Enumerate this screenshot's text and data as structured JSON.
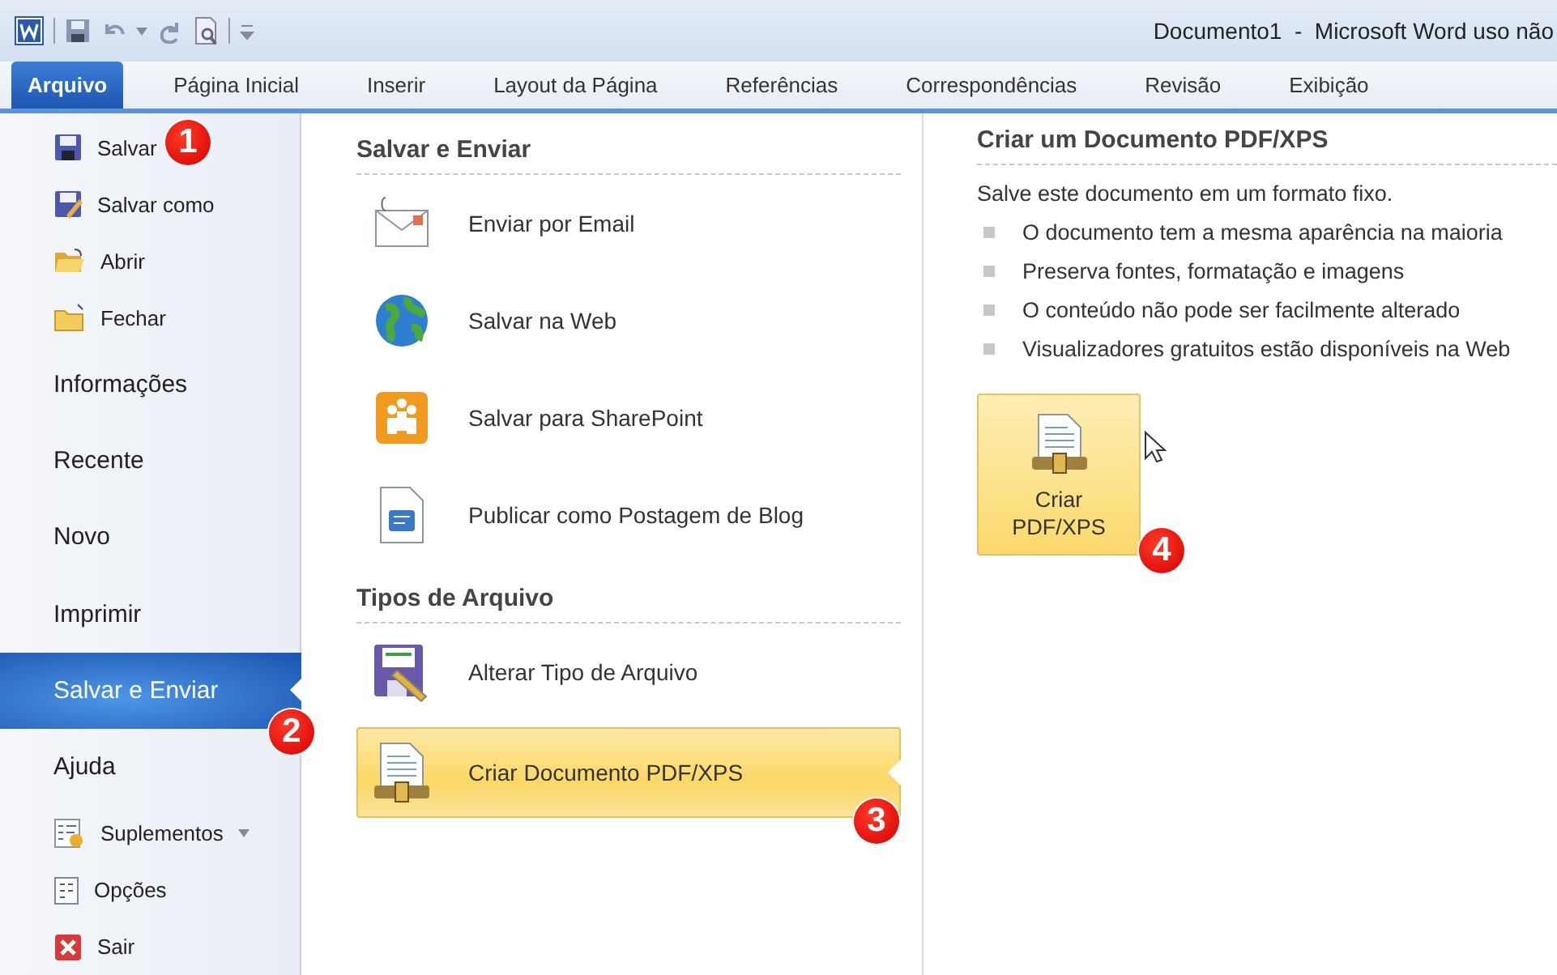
{
  "window": {
    "title": "Documento1  -  Microsoft Word uso não"
  },
  "ribbon_tabs": [
    {
      "label": "Arquivo",
      "selected": true
    },
    {
      "label": "Página Inicial",
      "selected": false
    },
    {
      "label": "Inserir",
      "selected": false
    },
    {
      "label": "Layout da Página",
      "selected": false
    },
    {
      "label": "Referências",
      "selected": false
    },
    {
      "label": "Correspondências",
      "selected": false
    },
    {
      "label": "Revisão",
      "selected": false
    },
    {
      "label": "Exibição",
      "selected": false
    }
  ],
  "backstage_menu": [
    {
      "label": "Salvar",
      "kind": "command",
      "selected": false
    },
    {
      "label": "Salvar como",
      "kind": "command",
      "selected": false
    },
    {
      "label": "Abrir",
      "kind": "command",
      "selected": false
    },
    {
      "label": "Fechar",
      "kind": "command",
      "selected": false
    },
    {
      "label": "Informações",
      "kind": "page",
      "selected": false
    },
    {
      "label": "Recente",
      "kind": "page",
      "selected": false
    },
    {
      "label": "Novo",
      "kind": "page",
      "selected": false
    },
    {
      "label": "Imprimir",
      "kind": "page",
      "selected": false
    },
    {
      "label": "Salvar e Enviar",
      "kind": "page",
      "selected": true
    },
    {
      "label": "Ajuda",
      "kind": "page",
      "selected": false
    },
    {
      "label": "Suplementos",
      "kind": "submenu",
      "selected": false
    },
    {
      "label": "Opções",
      "kind": "command",
      "selected": false
    },
    {
      "label": "Sair",
      "kind": "command",
      "selected": false
    }
  ],
  "save_send": {
    "sections": [
      {
        "title": "Salvar e Enviar",
        "items": [
          {
            "label": "Enviar por Email",
            "selected": false
          },
          {
            "label": "Salvar na Web",
            "selected": false
          },
          {
            "label": "Salvar para SharePoint",
            "selected": false
          },
          {
            "label": "Publicar como Postagem de Blog",
            "selected": false
          }
        ]
      },
      {
        "title": "Tipos de Arquivo",
        "items": [
          {
            "label": "Alterar Tipo de Arquivo",
            "selected": false
          },
          {
            "label": "Criar Documento PDF/XPS",
            "selected": true
          }
        ]
      }
    ]
  },
  "pdf_panel": {
    "title": "Criar um Documento PDF/XPS",
    "description": "Salve este documento em um formato fixo.",
    "bullets": [
      "O documento tem a mesma aparência na maioria",
      "Preserva fontes, formatação e imagens",
      "O conteúdo não pode ser facilmente alterado",
      "Visualizadores gratuitos estão disponíveis na Web"
    ],
    "button": {
      "label": "Criar PDF/XPS"
    }
  },
  "callouts": [
    "1",
    "2",
    "3",
    "4"
  ]
}
